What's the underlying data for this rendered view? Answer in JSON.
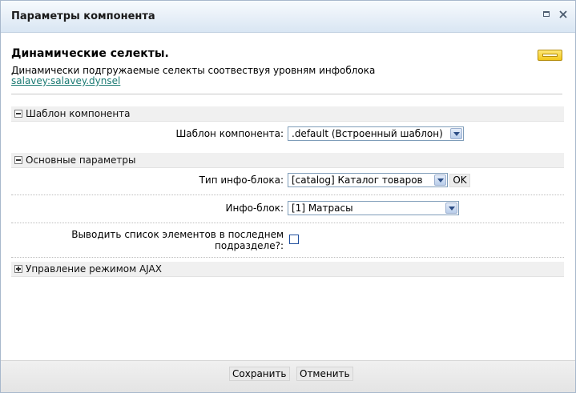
{
  "dialog": {
    "title": "Параметры компонента"
  },
  "component": {
    "name": "Динамические селекты.",
    "description": "Динамически подгружаемые селекты соотвествуя уровням инфоблока",
    "id_link": "salavey:salavey.dynsel"
  },
  "sections": {
    "template": {
      "label": "Шаблон компонента",
      "state": "expanded",
      "template_label": "Шаблон компонента:",
      "template_value": ".default (Встроенный шаблон)"
    },
    "main": {
      "label": "Основные параметры",
      "state": "expanded",
      "iblock_type_label": "Тип инфо-блока:",
      "iblock_type_value": "[catalog] Каталог товаров",
      "ok_label": "OK",
      "iblock_label": "Инфо-блок:",
      "iblock_value": "[1] Матрасы",
      "show_last_line1": "Выводить список элементов в последнем",
      "show_last_line2": "подразделе?:",
      "show_last_checked": false
    },
    "ajax": {
      "label": "Управление режимом AJAX",
      "state": "collapsed"
    }
  },
  "footer": {
    "save_label": "Сохранить",
    "cancel_label": "Отменить"
  },
  "colors": {
    "titlebar": "#d9e6f3",
    "link": "#1b7a73",
    "section_bg": "#f0f0f0"
  }
}
